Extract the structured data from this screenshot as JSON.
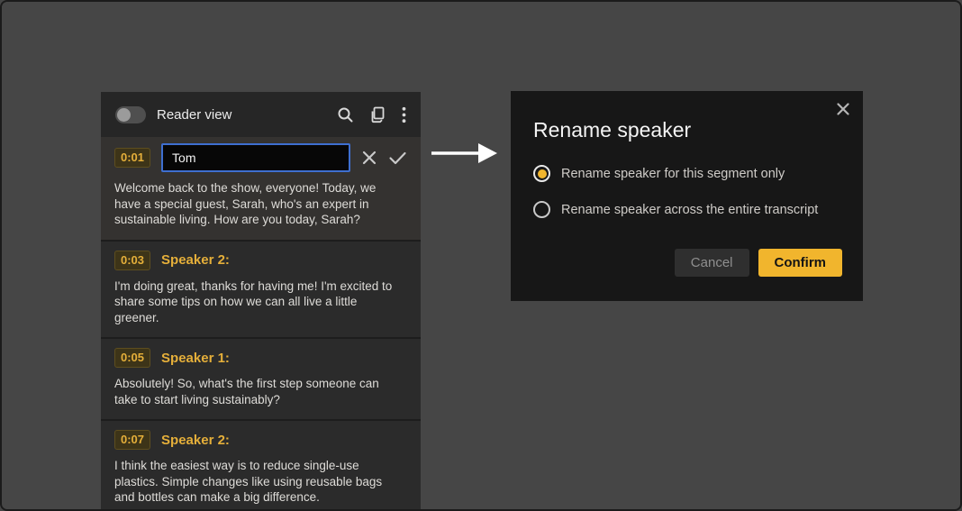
{
  "colors": {
    "accent_amber": "#f1b52d",
    "badge_text": "#e5af3a",
    "input_focus_border": "#3e6fd0",
    "panel_background": "#2b2b2b",
    "dialog_background": "#171717"
  },
  "icons": {
    "search": "magnifier",
    "copy": "overlapping-pages",
    "overflow_menu": "vertical-ellipsis",
    "cancel_edit": "x-mark",
    "confirm_edit": "check-mark",
    "dialog_close": "x-mark",
    "flow_arrow": "right-arrow"
  },
  "left_panel": {
    "header": {
      "toggle_label": "Reader view",
      "toggle_state": "off"
    },
    "edit_segment": {
      "timestamp": "0:01",
      "input_value": "Tom",
      "text": "Welcome back to the show, everyone! Today, we have a special guest, Sarah, who's an expert in sustainable living. How are you today, Sarah?"
    },
    "segments": [
      {
        "timestamp": "0:03",
        "speaker": "Speaker 2:",
        "text": "I'm doing great, thanks for having me! I'm excited to share some tips on how we can all live a little greener."
      },
      {
        "timestamp": "0:05",
        "speaker": "Speaker 1:",
        "text": "Absolutely! So, what's the first step someone can take to start living sustainably?"
      },
      {
        "timestamp": "0:07",
        "speaker": "Speaker 2:",
        "text": " I think the easiest way is to reduce single-use plastics. Simple changes like using reusable bags and bottles can make a big difference."
      }
    ]
  },
  "dialog": {
    "title": "Rename speaker",
    "options": [
      {
        "label": "Rename speaker for this segment only",
        "selected": true
      },
      {
        "label": "Rename speaker across the entire transcript",
        "selected": false
      }
    ],
    "cancel_label": "Cancel",
    "confirm_label": "Confirm"
  }
}
